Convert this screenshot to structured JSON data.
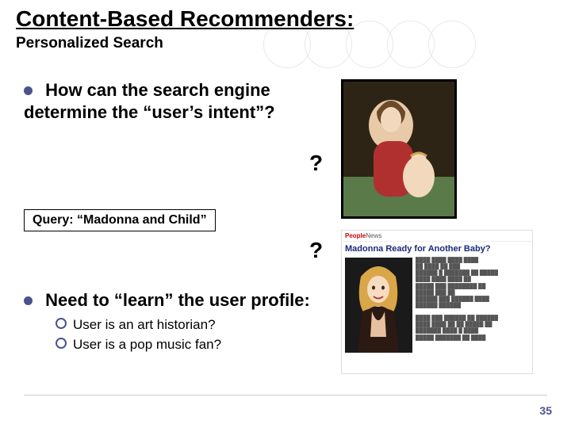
{
  "title": "Content-Based Recommenders:",
  "subtitle": "Personalized Search",
  "bullet1": "How can the search engine determine the “user’s intent”?",
  "query_label": "Query: “Madonna and Child”",
  "qmark": "?",
  "bullet2": "Need to “learn” the user profile:",
  "sub1": "User is an art historian?",
  "sub2": "User is a pop music fan?",
  "news": {
    "source_prefix": "People",
    "source_suffix": "News",
    "headline": "Madonna Ready for Another Baby?"
  },
  "page_number": "35"
}
